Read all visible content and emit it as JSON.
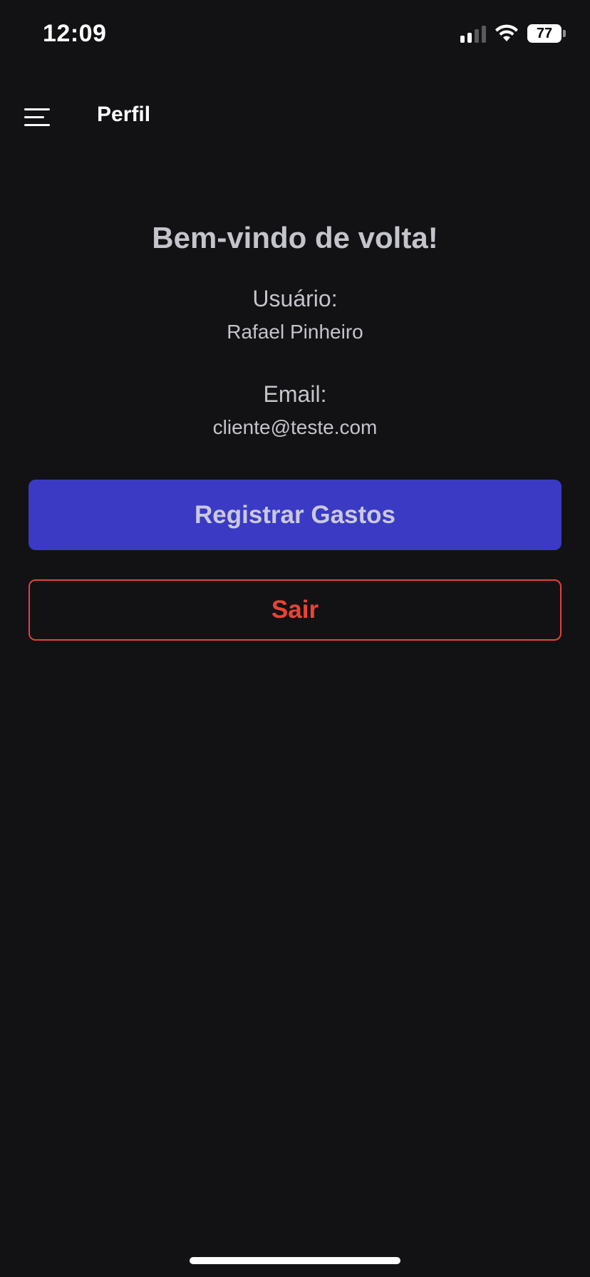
{
  "status_bar": {
    "time": "12:09",
    "battery_level": "77",
    "icons": [
      "cellular-signal-icon",
      "wifi-icon",
      "battery-icon"
    ]
  },
  "header": {
    "title": "Perfil",
    "menu_icon": "hamburger-menu-icon"
  },
  "profile": {
    "welcome": "Bem-vindo de volta!",
    "user_label": "Usuário:",
    "user_name": "Rafael Pinheiro",
    "email_label": "Email:",
    "email": "cliente@teste.com"
  },
  "actions": {
    "register_expenses_label": "Registrar Gastos",
    "logout_label": "Sair"
  },
  "colors": {
    "background": "#121214",
    "primary_button": "#3b3ac4",
    "danger": "#ea4335",
    "text": "#c4c4cc"
  }
}
